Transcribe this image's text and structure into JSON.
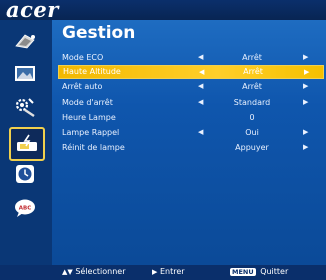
{
  "brand": "acer",
  "panel": {
    "title": "Gestion",
    "rows": [
      {
        "label": "Mode ECO",
        "value": "Arrêt",
        "arrows": true
      },
      {
        "label": "Haute Altitude",
        "value": "Arrêt",
        "arrows": true
      },
      {
        "label": "Arrêt auto",
        "value": "Arrêt",
        "arrows": true
      },
      {
        "label": "Mode d'arrêt",
        "value": "Standard",
        "arrows": true
      },
      {
        "label": "Heure Lampe",
        "value": "0",
        "arrows": false
      },
      {
        "label": "Lampe Rappel",
        "value": "Oui",
        "arrows": true
      },
      {
        "label": "Réinit de lampe",
        "value": "Appuyer",
        "arrows": false,
        "right_arrow": true
      }
    ],
    "selected_index": 1
  },
  "sidebar": {
    "icons": [
      "color-icon",
      "image-icon",
      "settings-icon",
      "management-icon",
      "timer-icon",
      "language-icon"
    ],
    "active_index": 3
  },
  "footer": {
    "select_label": "Sélectionner",
    "enter_label": "Entrer",
    "menu_badge": "MENU",
    "quit_label": "Quitter"
  },
  "colors": {
    "selection": "#f5c000",
    "highlight_border": "#f1d04d",
    "background": "#0b3f86"
  }
}
